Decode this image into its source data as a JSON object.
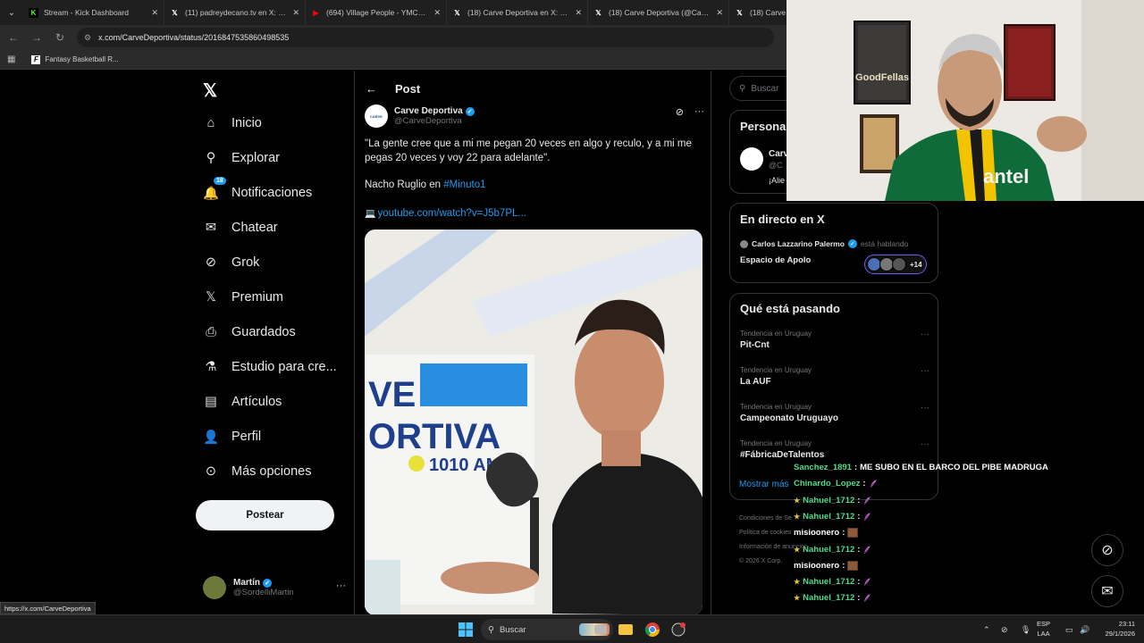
{
  "browser": {
    "tabs": [
      {
        "title": "Stream - Kick Dashboard",
        "favicon": "kick-icon",
        "color": "#53fc18"
      },
      {
        "title": "(11) padreydecano.tv en X: \"El d",
        "favicon": "x-icon",
        "color": "#ffffff"
      },
      {
        "title": "(694) Village People - YMCA | T",
        "favicon": "youtube-icon",
        "color": "#ff0000"
      },
      {
        "title": "(18) Carve Deportiva en X: \"\"Q",
        "favicon": "x-icon",
        "color": "#ffffff"
      },
      {
        "title": "(18) Carve Deportiva (@CarveD",
        "favicon": "x-icon",
        "color": "#ffffff"
      },
      {
        "title": "(18) Carve D",
        "favicon": "x-icon",
        "color": "#ffffff"
      }
    ],
    "url": "x.com/CarveDeportiva/status/2016847535860498535",
    "bookmark": "Fantasy Basketball R...",
    "status_url": "https://x.com/CarveDeportiva"
  },
  "nav": {
    "items": [
      {
        "label": "Inicio",
        "icon": "home-icon"
      },
      {
        "label": "Explorar",
        "icon": "search-icon"
      },
      {
        "label": "Notificaciones",
        "icon": "bell-icon",
        "badge": "18"
      },
      {
        "label": "Chatear",
        "icon": "mail-icon"
      },
      {
        "label": "Grok",
        "icon": "grok-icon"
      },
      {
        "label": "Premium",
        "icon": "x-icon"
      },
      {
        "label": "Guardados",
        "icon": "bookmark-icon"
      },
      {
        "label": "Estudio para cre...",
        "icon": "flask-icon"
      },
      {
        "label": "Artículos",
        "icon": "article-icon"
      },
      {
        "label": "Perfil",
        "icon": "person-icon"
      },
      {
        "label": "Más opciones",
        "icon": "more-circle-icon"
      }
    ],
    "post_button": "Postear",
    "account": {
      "name": "Martín",
      "handle": "@SordelliMartin"
    }
  },
  "post": {
    "header": "Post",
    "author_name": "Carve Deportiva",
    "author_handle": "@CarveDeportiva",
    "text": "\"La gente cree que a mi me pegan 20 veces en algo y reculo, y a mi me pegas 20 veces y voy 22 para adelante\".",
    "line2_prefix": "Nacho Ruglio en ",
    "line2_hashtag": "#Minuto1",
    "link": "youtube.com/watch?v=J5b7PL...",
    "image": {
      "wall_line1": "VE",
      "wall_line2": "ORTIVA",
      "wall_line3": "1010 AM"
    }
  },
  "sidebar": {
    "search_placeholder": "Buscar",
    "personalize_title": "Persona",
    "personalize_name": "Carv",
    "personalize_handle": "@C",
    "personalize_text": "¡Alie",
    "live": {
      "title": "En directo en X",
      "host": "Carlos Lazzarino Palermo",
      "host_status": "está hablando",
      "space": "Espacio de Apolo",
      "count": "+14"
    },
    "trends_title": "Qué está pasando",
    "trends": [
      {
        "context": "Tendencia en Uruguay",
        "name": "Pit-Cnt"
      },
      {
        "context": "Tendencia en Uruguay",
        "name": "La AUF"
      },
      {
        "context": "Tendencia en Uruguay",
        "name": "Campeonato Uruguayo"
      },
      {
        "context": "Tendencia en Uruguay",
        "name": "#FábricaDeTalentos"
      }
    ],
    "show_more": "Mostrar más",
    "footer": [
      "Condiciones de Se",
      "Política de cookies",
      "Información de anuncios",
      "© 2026 X Corp."
    ]
  },
  "chat": [
    {
      "user": "Sanchez_1891",
      "color": "#4ddc8c",
      "star": false,
      "msg": "ME SUBO EN EL BARCO DEL PIBE MADRUGA",
      "emote": ""
    },
    {
      "user": "Chinardo_Lopez",
      "color": "#4ddc8c",
      "star": false,
      "msg": "",
      "emote": "feather"
    },
    {
      "user": "Nahuel_1712",
      "color": "#4ddc8c",
      "star": true,
      "msg": "",
      "emote": "feather"
    },
    {
      "user": "Nahuel_1712",
      "color": "#4ddc8c",
      "star": true,
      "msg": "",
      "emote": "feather"
    },
    {
      "user": "misioonero",
      "color": "#ffffff",
      "star": false,
      "msg": "",
      "emote": "box"
    },
    {
      "user": "Nahuel_1712",
      "color": "#4ddc8c",
      "star": true,
      "msg": "",
      "emote": "feather"
    },
    {
      "user": "misioonero",
      "color": "#ffffff",
      "star": false,
      "msg": "",
      "emote": "box"
    },
    {
      "user": "Nahuel_1712",
      "color": "#4ddc8c",
      "star": true,
      "msg": "",
      "emote": "feather"
    },
    {
      "user": "Nahuel_1712",
      "color": "#4ddc8c",
      "star": true,
      "msg": "",
      "emote": "feather"
    }
  ],
  "taskbar": {
    "search": "Buscar",
    "lang_line1": "ESP",
    "lang_line2": "LAA",
    "time": "23:11",
    "date": "29/1/2026"
  },
  "colors": {
    "accent": "#1d9bf0",
    "live_border": "#7856ff",
    "chat_green": "#4ddc8c"
  }
}
